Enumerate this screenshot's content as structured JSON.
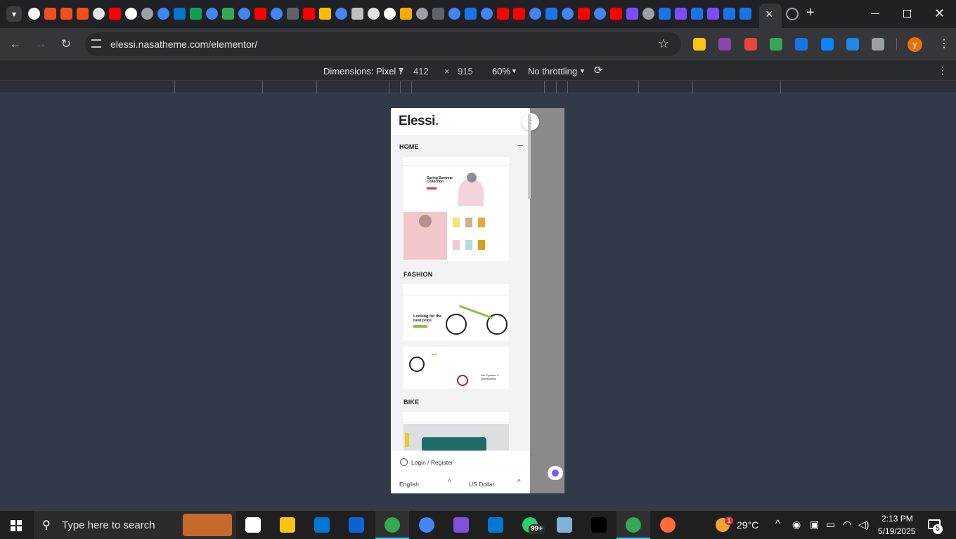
{
  "browser": {
    "url": "elessi.nasatheme.com/elementor/",
    "tab_close": "×",
    "new_tab": "+",
    "profile_initial": "y",
    "tab_icons": [
      "github-icon",
      "figma-icon",
      "figma-icon",
      "figma-icon",
      "openai-icon",
      "youtube-icon",
      "github-icon",
      "globe-icon",
      "google-icon",
      "dell-icon",
      "sheets-icon",
      "google-icon",
      "shield-icon",
      "google-icon",
      "youtube-icon",
      "google-icon",
      "tab-icon",
      "youtube-icon",
      "drive-icon",
      "google-icon",
      "bank-icon",
      "openai-icon",
      "github-icon",
      "game-icon",
      "globe-icon",
      "tab-icon",
      "google-icon",
      "app-icon",
      "google-icon",
      "youtube-icon",
      "youtube-icon",
      "google-icon",
      "app-icon",
      "google-icon",
      "youtube-icon",
      "google-icon",
      "youtube-icon",
      "vuetify-icon",
      "globe-icon",
      "app-icon",
      "vuetify-icon",
      "app-icon",
      "vuetify-icon",
      "app-icon",
      "app-icon"
    ],
    "extensions": [
      "keep-icon",
      "brain-icon",
      "pdf-icon",
      "photo-icon",
      "mail-icon",
      "edge-icon",
      "font-icon",
      "puzzle-icon"
    ]
  },
  "devtools": {
    "dimensions_label": "Dimensions: Pixel 7",
    "width": "412",
    "times": "×",
    "height": "915",
    "zoom": "60%",
    "throttling": "No throttling"
  },
  "site": {
    "logo": "Elessi",
    "logo_dot": ".",
    "sections": [
      "HOME",
      "FASHION",
      "BIKE"
    ],
    "hero": {
      "title": "Spring Summer Collection",
      "bike_title": "Looking for the best price",
      "bike_caption": "Die Cyclone 4 Accessories"
    },
    "login": "Login / Register",
    "language": "English",
    "currency": "US Dollar"
  },
  "taskbar": {
    "search_placeholder": "Type here to search",
    "notif_badge": "99+",
    "weather_badge": "1",
    "temperature": "29°C",
    "time": "2:13 PM",
    "date": "5/19/2025",
    "notification_count": "5"
  },
  "colors": {
    "accent_red": "#e2343f",
    "bike_green": "#8bc34a",
    "chrome_dark": "#202124",
    "page_bg": "#323a49"
  }
}
